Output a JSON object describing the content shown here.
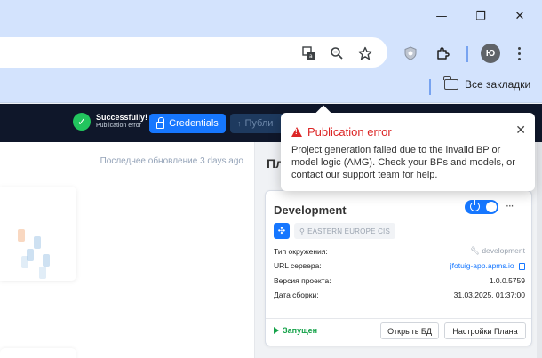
{
  "browser": {
    "window_controls": {
      "minimize": "—",
      "restore": "❐",
      "close": "✕"
    },
    "toolbar_icons": [
      "translate-icon",
      "zoom-icon",
      "bookmark-star-icon",
      "shield-extension-icon",
      "extensions-puzzle-icon"
    ],
    "profile_initial": "Ю",
    "bookmarks_all_label": "Все закладки"
  },
  "appbar": {
    "success_title": "Successfully!",
    "success_subtitle": "Publication error",
    "credentials_label": "Credentials",
    "publish_label": "Публи"
  },
  "left": {
    "last_update": "Последнее обновление 3 days ago"
  },
  "right": {
    "title": "Пл"
  },
  "env": {
    "name": "Development",
    "region": "EASTERN EUROPE CIS",
    "rows": [
      {
        "key": "Тип окружения:",
        "value": "development"
      },
      {
        "key": "URL сервера:",
        "value": "jfotuig-app.apms.io"
      },
      {
        "key": "Версия проекта:",
        "value": "1.0.0.5759"
      },
      {
        "key": "Дата сборки:",
        "value": "31.03.2025, 01:37:00"
      }
    ],
    "status": "Запущен",
    "open_db_label": "Открыть БД",
    "plan_settings_label": "Настройки Плана",
    "toggle_on": true
  },
  "error_popup": {
    "title": "Publication error",
    "message": "Project generation failed due to the invalid BP or model logic (AMG). Check your BPs and models, or contact our support team for help."
  },
  "colors": {
    "accent": "#1677ff",
    "error": "#dc2626",
    "success": "#22c55e",
    "header_bg": "#0f172a",
    "chrome_bg": "#d3e3fd"
  }
}
